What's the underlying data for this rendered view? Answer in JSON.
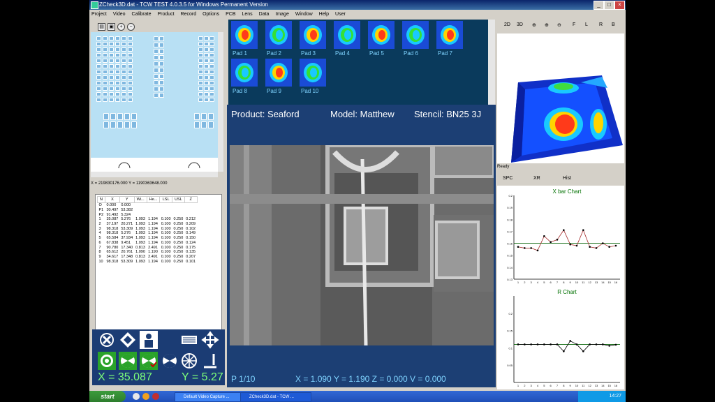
{
  "window": {
    "title": "ZCheck3D.dat - TCW TEST 4.0.3.5 for Windows Permanent Version",
    "minimize": "_",
    "maximize": "□",
    "close": "×"
  },
  "menu": [
    "Project",
    "Video",
    "Calibrate",
    "Product",
    "Record",
    "Options",
    "PCB",
    "Lens",
    "Data",
    "Image",
    "Window",
    "Help",
    "User"
  ],
  "coord_line": "X = 219830176.000 Y = 1190363648.000",
  "table": {
    "headers": [
      "N",
      "X",
      "Y",
      "Wi...",
      "He...",
      "LSL",
      "USL",
      "Z"
    ],
    "rows": [
      [
        "O",
        "0.000",
        "0.000",
        "",
        "",
        "",
        "",
        ""
      ],
      [
        "P1",
        "30.497",
        "53.382",
        "",
        "",
        "",
        "",
        ""
      ],
      [
        "P2",
        "91.492",
        "5.324",
        "",
        "",
        "",
        "",
        ""
      ],
      [
        "1",
        "35.087",
        "5.276",
        "1.093",
        "1.194",
        "0.100",
        "0.250",
        "0.212"
      ],
      [
        "2",
        "37.197",
        "20.271",
        "1.093",
        "1.194",
        "0.100",
        "0.250",
        "0.209"
      ],
      [
        "3",
        "98.318",
        "53.309",
        "1.093",
        "1.194",
        "0.100",
        "0.250",
        "0.102"
      ],
      [
        "4",
        "98.318",
        "5.276",
        "1.093",
        "1.194",
        "0.100",
        "0.250",
        "0.149"
      ],
      [
        "5",
        "65.584",
        "37.934",
        "1.093",
        "1.194",
        "0.100",
        "0.250",
        "0.150"
      ],
      [
        "6",
        "67.838",
        "9.451",
        "1.093",
        "1.194",
        "0.100",
        "0.250",
        "0.124"
      ],
      [
        "7",
        "90.780",
        "17.340",
        "0.813",
        "2.491",
        "0.100",
        "0.250",
        "0.175"
      ],
      [
        "8",
        "65.612",
        "20.761",
        "1.090",
        "1.190",
        "0.100",
        "0.250",
        "0.135"
      ],
      [
        "9",
        "34.617",
        "17.348",
        "0.813",
        "2.491",
        "0.100",
        "0.250",
        "0.207"
      ],
      [
        "10",
        "98.318",
        "53.309",
        "1.093",
        "1.194",
        "0.100",
        "0.250",
        "0.101"
      ]
    ]
  },
  "status_x": "X = 35.087",
  "status_y": "Y = 5.27",
  "pads": [
    "Pad 1",
    "Pad 2",
    "Pad 3",
    "Pad 4",
    "Pad 5",
    "Pad 6",
    "Pad 7",
    "Pad 8",
    "Pad 9",
    "Pad 10"
  ],
  "camera": {
    "product": "Product: Seaford",
    "model": "Model: Matthew",
    "stencil": "Stencil: BN25 3J",
    "page": "P 1/10",
    "readout": "X = 1.090 Y = 1.190 Z = 0.000 V = 0.000"
  },
  "right_toolbar": [
    "2D",
    "3D",
    "F",
    "L",
    "R",
    "B"
  ],
  "ready": "Ready",
  "spc_tabs": [
    "SPC",
    "XR",
    "Hist"
  ],
  "taskbar": {
    "start": "start",
    "tasks": [
      "Default Video Capture ...",
      "ZCheck3D.dat - TCW ..."
    ],
    "clock": "14:27"
  },
  "colors": {
    "accent": "#1c3f74",
    "readout_green": "#7dff7a",
    "label_blue": "#7fd3ff"
  },
  "chart_data": [
    {
      "type": "line",
      "title": "X bar Chart",
      "x": [
        1,
        2,
        3,
        4,
        5,
        6,
        7,
        8,
        9,
        10,
        11,
        12,
        13,
        14,
        15,
        16
      ],
      "yticks": [
        0.2,
        0.19,
        0.18,
        0.17,
        0.16,
        0.15,
        0.14,
        0.13
      ],
      "ylim": [
        0.13,
        0.2
      ],
      "series": [
        {
          "values": [
            0.157,
            0.156,
            0.156,
            0.154,
            0.166,
            0.161,
            0.163,
            0.171,
            0.159,
            0.158,
            0.171,
            0.157,
            0.156,
            0.16,
            0.157,
            0.158
          ]
        }
      ],
      "center_line": 0.16
    },
    {
      "type": "line",
      "title": "R Chart",
      "x": [
        1,
        2,
        3,
        4,
        5,
        6,
        7,
        8,
        9,
        10,
        11,
        12,
        13,
        14,
        15,
        16
      ],
      "yticks": [
        0.2,
        0.15,
        0.1,
        0.05
      ],
      "ylim": [
        0.0,
        0.25
      ],
      "series": [
        {
          "values": [
            0.11,
            0.11,
            0.11,
            0.11,
            0.11,
            0.11,
            0.11,
            0.09,
            0.12,
            0.11,
            0.09,
            0.11,
            0.11,
            0.11,
            0.106,
            0.109
          ]
        }
      ],
      "center_line": 0.11
    }
  ]
}
